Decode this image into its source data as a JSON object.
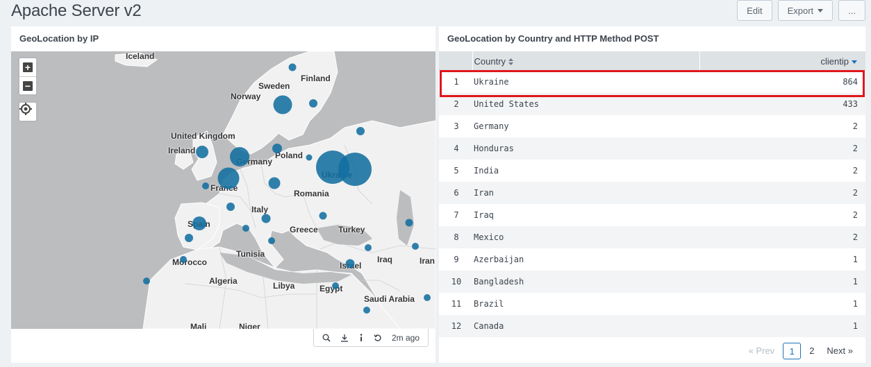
{
  "dashboard": {
    "title": "Apache Server v2"
  },
  "actions": {
    "edit": "Edit",
    "export": "Export",
    "more": "..."
  },
  "map_panel": {
    "title": "GeoLocation by IP",
    "labels": [
      {
        "text": "Iceland"
      },
      {
        "text": "Finland"
      },
      {
        "text": "Sweden"
      },
      {
        "text": "Norway"
      },
      {
        "text": "United Kingdom"
      },
      {
        "text": "Ireland"
      },
      {
        "text": "Germany"
      },
      {
        "text": "Poland"
      },
      {
        "text": "Ukraine"
      },
      {
        "text": "France"
      },
      {
        "text": "Romania"
      },
      {
        "text": "Italy"
      },
      {
        "text": "Spain"
      },
      {
        "text": "Greece"
      },
      {
        "text": "Turkey"
      },
      {
        "text": "Tunisia"
      },
      {
        "text": "Morocco"
      },
      {
        "text": "Iraq"
      },
      {
        "text": "Iran"
      },
      {
        "text": "Israel"
      },
      {
        "text": "Algeria"
      },
      {
        "text": "Libya"
      },
      {
        "text": "Egypt"
      },
      {
        "text": "Saudi Arabia"
      },
      {
        "text": "Mali"
      },
      {
        "text": "Niger"
      }
    ],
    "footer": {
      "updated": "2m ago"
    }
  },
  "table_panel": {
    "title": "GeoLocation by Country and HTTP Method POST",
    "columns": {
      "country": "Country",
      "clientip": "clientip"
    },
    "rows": [
      {
        "n": "1",
        "country": "Ukraine",
        "clientip": "864"
      },
      {
        "n": "2",
        "country": "United States",
        "clientip": "433"
      },
      {
        "n": "3",
        "country": "Germany",
        "clientip": "2"
      },
      {
        "n": "4",
        "country": "Honduras",
        "clientip": "2"
      },
      {
        "n": "5",
        "country": "India",
        "clientip": "2"
      },
      {
        "n": "6",
        "country": "Iran",
        "clientip": "2"
      },
      {
        "n": "7",
        "country": "Iraq",
        "clientip": "2"
      },
      {
        "n": "8",
        "country": "Mexico",
        "clientip": "2"
      },
      {
        "n": "9",
        "country": "Azerbaijan",
        "clientip": "1"
      },
      {
        "n": "10",
        "country": "Bangladesh",
        "clientip": "1"
      },
      {
        "n": "11",
        "country": "Brazil",
        "clientip": "1"
      },
      {
        "n": "12",
        "country": "Canada",
        "clientip": "1"
      }
    ],
    "pager": {
      "prev": "« Prev",
      "pages": [
        "1",
        "2"
      ],
      "next": "Next »"
    }
  },
  "colors": {
    "bubble": "#136ea0",
    "highlight": "#e0161c",
    "active_page": "#1a72b8"
  }
}
